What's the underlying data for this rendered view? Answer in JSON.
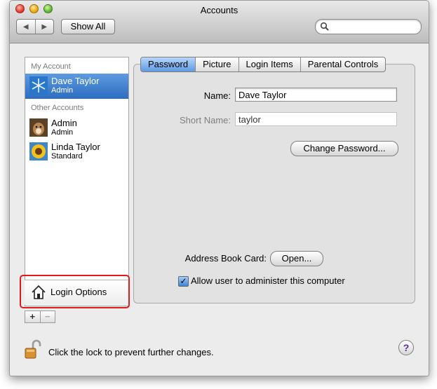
{
  "window": {
    "title": "Accounts"
  },
  "toolbar": {
    "back_icon": "triangle-left",
    "forward_icon": "triangle-right",
    "show_all_label": "Show All",
    "search_value": ""
  },
  "sidebar": {
    "my_account_header": "My Account",
    "other_accounts_header": "Other Accounts",
    "my_account": {
      "name": "Dave Taylor",
      "role": "Admin",
      "avatar": "snowflake"
    },
    "other_accounts": [
      {
        "name": "Admin",
        "role": "Admin",
        "avatar": "dog"
      },
      {
        "name": "Linda Taylor",
        "role": "Standard",
        "avatar": "sunflower"
      }
    ],
    "login_options_label": "Login Options",
    "add_label": "+",
    "remove_label": "−"
  },
  "tabs": [
    "Password",
    "Picture",
    "Login Items",
    "Parental Controls"
  ],
  "active_tab": "Password",
  "form": {
    "name_label": "Name:",
    "name_value": "Dave Taylor",
    "short_name_label": "Short Name:",
    "short_name_value": "taylor",
    "change_password_label": "Change Password...",
    "address_book_label": "Address Book Card:",
    "open_label": "Open...",
    "allow_admin_label": "Allow user to administer this computer",
    "allow_admin_checked": true
  },
  "footer": {
    "lock_text": "Click the lock to prevent further changes.",
    "help_label": "?"
  },
  "colors": {
    "selection": "#3f7fd0",
    "highlight_box": "#e11a1a"
  }
}
